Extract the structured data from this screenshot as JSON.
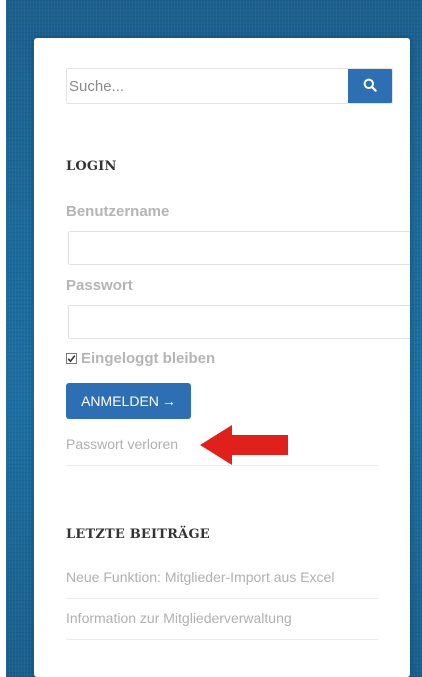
{
  "search": {
    "placeholder": "Suche..."
  },
  "login": {
    "heading": "LOGIN",
    "username_label": "Benutzername",
    "username_value": "",
    "password_label": "Passwort",
    "password_value": "",
    "remember_label": "Eingeloggt bleiben",
    "remember_checked": true,
    "submit_label": "ANMELDEN",
    "submit_arrow": "→",
    "lost_password": "Passwort verloren"
  },
  "recent_posts": {
    "heading": "LETZTE BEITRÄGE",
    "items": [
      "Neue Funktion: Mitglieder-Import aus Excel",
      "Information zur Mitgliederverwaltung"
    ]
  },
  "colors": {
    "accent": "#2e6fb3",
    "annotation_arrow": "#e0201b",
    "background": "#1a6a9c"
  },
  "icons": {
    "search_button": "search-icon",
    "annotation": "red-arrow-icon"
  }
}
